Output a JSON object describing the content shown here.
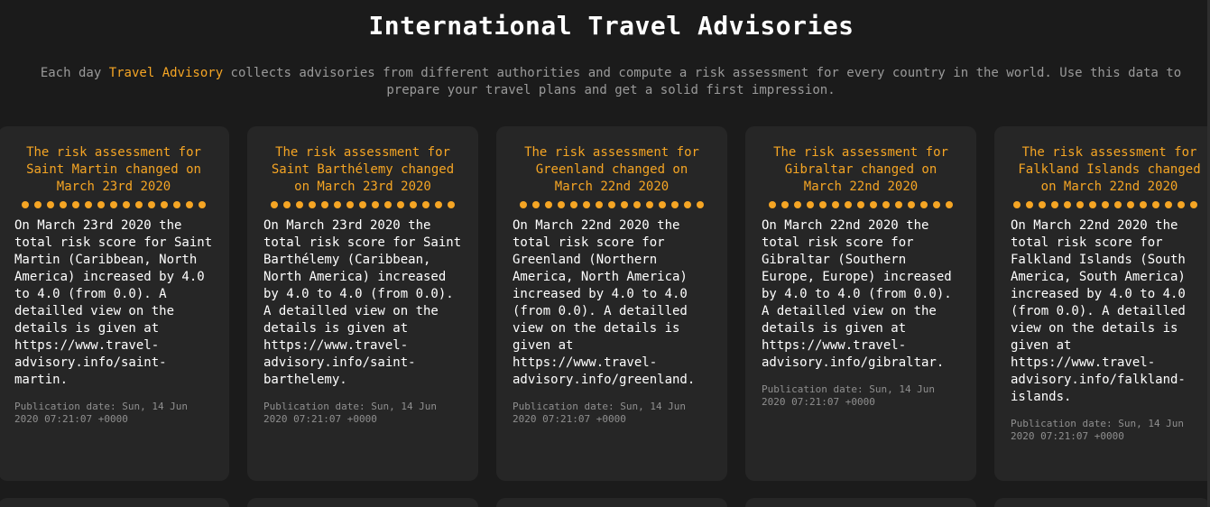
{
  "header": {
    "title": "International Travel Advisories"
  },
  "intro": {
    "prefix": "Each day ",
    "link_label": "Travel Advisory",
    "suffix": " collects advisories from different authorities and compute a risk assessment for every country in the world. Use this data to prepare your travel plans and get a solid first impression."
  },
  "colors": {
    "background": "#1b1b1b",
    "card_background": "#262626",
    "accent": "#f5a524",
    "muted_text": "#9a9a9a"
  },
  "cards": [
    {
      "title": "The risk assessment for Saint Martin changed on March 23rd 2020",
      "body": "On March 23rd 2020 the total risk score for Saint Martin (Caribbean, North America) increased by 4.0 to 4.0 (from 0.0). A detailled view on the details is given at https://www.travel-advisory.info/saint-martin.",
      "date": "Publication date: Sun, 14 Jun 2020 07:21:07 +0000"
    },
    {
      "title": "The risk assessment for Saint Barthélemy changed on March 23rd 2020",
      "body": "On March 23rd 2020 the total risk score for Saint Barthélemy (Caribbean, North America) increased by 4.0 to 4.0 (from 0.0). A detailled view on the details is given at https://www.travel-advisory.info/saint-barthelemy.",
      "date": "Publication date: Sun, 14 Jun 2020 07:21:07 +0000"
    },
    {
      "title": "The risk assessment for Greenland changed on March 22nd 2020",
      "body": "On March 22nd 2020 the total risk score for Greenland (Northern America, North America) increased by 4.0 to 4.0 (from 0.0). A detailled view on the details is given at https://www.travel-advisory.info/greenland.",
      "date": "Publication date: Sun, 14 Jun 2020 07:21:07 +0000"
    },
    {
      "title": "The risk assessment for Gibraltar changed on March 22nd 2020",
      "body": "On March 22nd 2020 the total risk score for Gibraltar (Southern Europe, Europe) increased by 4.0 to 4.0 (from 0.0). A detailled view on the details is given at https://www.travel-advisory.info/gibraltar.",
      "date": "Publication date: Sun, 14 Jun 2020 07:21:07 +0000"
    },
    {
      "title": "The risk assessment for Falkland Islands changed on March 22nd 2020",
      "body": "On March 22nd 2020 the total risk score for Falkland Islands (South America, South America) increased by 4.0 to 4.0 (from 0.0). A detailled view on the details is given at https://www.travel-advisory.info/falkland-islands.",
      "date": "Publication date: Sun, 14 Jun 2020 07:21:07 +0000"
    }
  ]
}
